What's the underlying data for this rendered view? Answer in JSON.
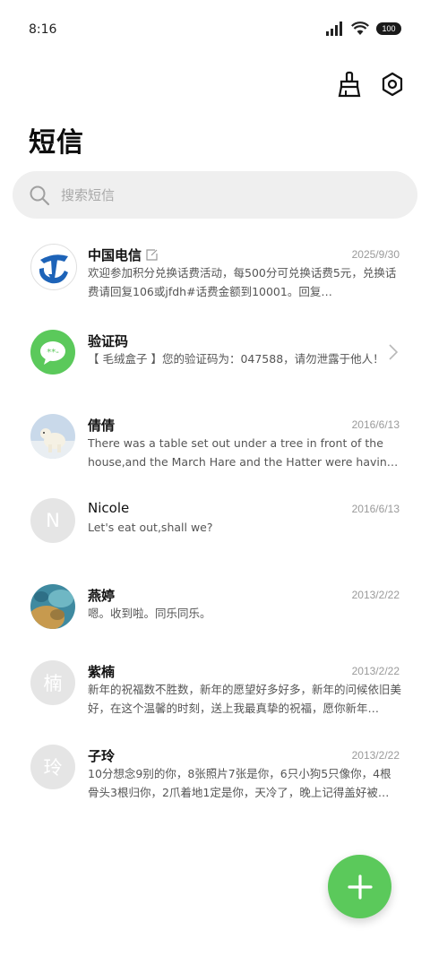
{
  "status": {
    "time": "8:16",
    "battery": "100"
  },
  "header": {
    "title": "短信"
  },
  "search": {
    "placeholder": "搜索短信"
  },
  "messages": [
    {
      "name": "中国电信",
      "date": "2025/9/30",
      "preview": "欢迎参加积分兑换话费活动，每500分可兑换话费5元，兑换话费请回复106或jfdh#话费金额到10001。回复…",
      "avatar": "china-telecom-logo"
    },
    {
      "name": "验证码",
      "date": "",
      "preview": "【 毛绒盒子 】您的验证码为：047588，请勿泄露于他人！",
      "avatar": "message-bubble-icon"
    },
    {
      "name": "倩倩",
      "date": "2016/6/13",
      "preview": "There was a table set out under a tree in front of the house,and the March Hare and the Hatter were having tea at it.",
      "avatar": "polar-bear-photo"
    },
    {
      "name": "Nicole",
      "date": "2016/6/13",
      "preview": "Let's eat out,shall we?",
      "avatar_letter": "N"
    },
    {
      "name": "燕婷",
      "date": "2013/2/22",
      "preview": "嗯。收到啦。同乐同乐。",
      "avatar": "landscape-photo"
    },
    {
      "name": "紫楠",
      "date": "2013/2/22",
      "preview": "新年的祝福数不胜数，新年的愿望好多好多，新年的问候依旧美好，在这个温馨的时刻，送上我最真挚的祝福，愿你新年…",
      "avatar_letter": "楠"
    },
    {
      "name": "子玲",
      "date": "2013/2/22",
      "preview": "10分想念9别的你，8张照片7张是你，6只小狗5只像你，4根骨头3根归你，2爪着地1定是你，天冷了，晚上记得盖好被…",
      "avatar_letter": "玲"
    }
  ],
  "colors": {
    "accent": "#5bc95b",
    "telecom_blue": "#1d63b8"
  }
}
